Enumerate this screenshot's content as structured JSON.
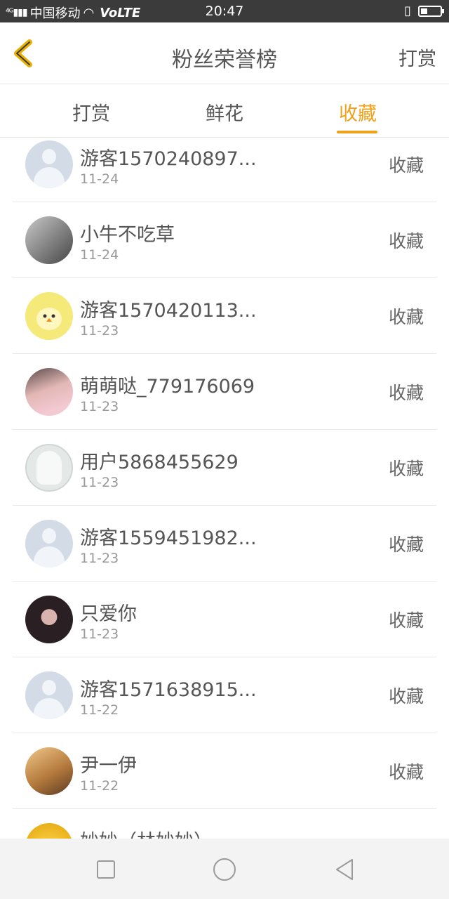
{
  "status_bar": {
    "carrier": "中国移动",
    "network": "VoLTE",
    "signal_label": "4G",
    "time": "20:47"
  },
  "header": {
    "title": "粉丝荣誉榜",
    "action_label": "打赏"
  },
  "tabs": [
    {
      "label": "打赏",
      "active": false
    },
    {
      "label": "鲜花",
      "active": false
    },
    {
      "label": "收藏",
      "active": true
    }
  ],
  "accent_color": "#f0a11a",
  "fans": [
    {
      "name": "游客1570240897...",
      "date": "11-24",
      "tag": "收藏",
      "avatar": "default-avatar"
    },
    {
      "name": "小牛不吃草",
      "date": "11-24",
      "tag": "收藏",
      "avatar": "photo-avatar"
    },
    {
      "name": "游客1570420113...",
      "date": "11-23",
      "tag": "收藏",
      "avatar": "cartoon-avatar"
    },
    {
      "name": "萌萌哒_779176069",
      "date": "11-23",
      "tag": "收藏",
      "avatar": "anime-girl-avatar"
    },
    {
      "name": "用户5868455629",
      "date": "11-23",
      "tag": "收藏",
      "avatar": "default-gray-avatar"
    },
    {
      "name": "游客1559451982...",
      "date": "11-23",
      "tag": "收藏",
      "avatar": "default-avatar"
    },
    {
      "name": "只爱你",
      "date": "11-23",
      "tag": "收藏",
      "avatar": "photo-avatar"
    },
    {
      "name": "游客1571638915...",
      "date": "11-22",
      "tag": "收藏",
      "avatar": "default-avatar"
    },
    {
      "name": "尹一伊",
      "date": "11-22",
      "tag": "收藏",
      "avatar": "photo-avatar"
    },
    {
      "name": "妙妙（林妙妙）",
      "date": "",
      "tag": "",
      "avatar": "photo-avatar"
    }
  ],
  "nav_bar": {
    "recent_icon": "square-icon",
    "home_icon": "circle-icon",
    "back_icon": "triangle-back-icon"
  }
}
